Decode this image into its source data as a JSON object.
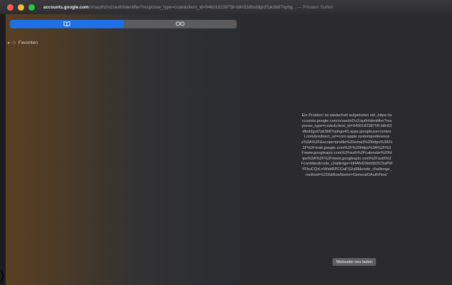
{
  "window": {
    "url_domain": "accounts.google.com",
    "url_path": "/o/oauth2/v2/auth/identifier?response_type=code&client_id=946018238758-b8n53dfoddgrd7pk3b87nphg...",
    "private_label": "— Privates Surfen"
  },
  "sidebar": {
    "tab_bookmarks_icon": "book-icon",
    "tab_reading_list_icon": "glasses-icon",
    "favorites_label": "Favoriten"
  },
  "content": {
    "error_message": "Ein Problem ist wiederholt aufgetreten mit „https://accounts.google.com/o/oauth2/v2/auth/identifier?response_type=code&client_id=946018238758-b8n53dfoddgrd7pk3b87nphge40.apps.googleusercontent.com&redirect_uri=com.apple.systempreferences%3A%2F&scope=profile%20email%20https%3A%2F%2Fmail.google.com%2F%20https%3A%2F%2Fwww.googleapis.com%2Fauth%2Fcalendar%20https%3A%2F%2Fwww.googleapis.com%2Fauth%2Fcarddav&code_challenge=Id4AfeD3eb5bDC5aPMYFbuCQzLnWsbRPCGaFS2u68&code_challenge_method=S256&flowName=GeneralOAuthFlow“",
    "reload_button": "Webseite neu laden"
  },
  "outside": {
    "paren": ")"
  }
}
